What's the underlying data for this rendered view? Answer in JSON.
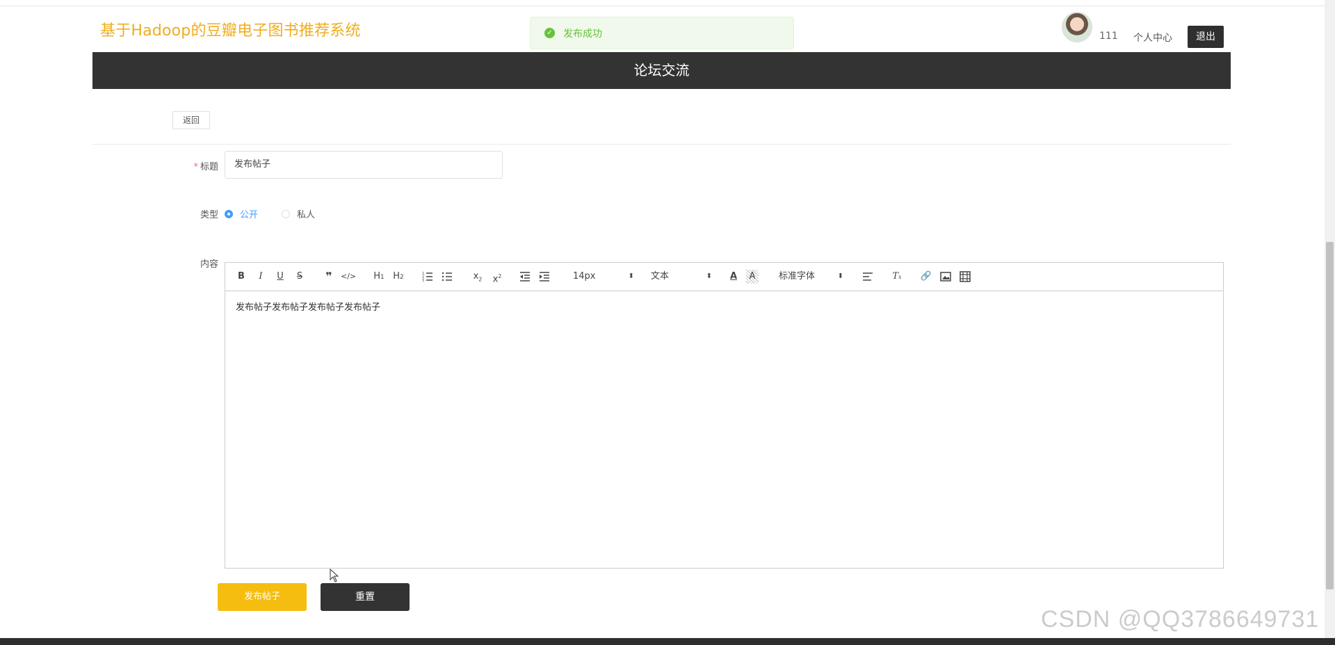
{
  "header": {
    "site_title": "基于Hadoop的豆瓣电子图书推荐系统",
    "username": "111",
    "profile_link": "个人中心",
    "logout": "退出"
  },
  "toast": {
    "icon": "check-circle-icon",
    "message": "发布成功"
  },
  "banner": {
    "title": "论坛交流"
  },
  "back_button": "返回",
  "form": {
    "title_label": "标题",
    "title_value": "发布帖子",
    "type_label": "类型",
    "type_options": [
      "公开",
      "私人"
    ],
    "type_selected": "公开",
    "content_label": "内容",
    "content_value": "发布帖子发布帖子发布帖子发布帖子"
  },
  "editor_toolbar": {
    "buttons": [
      "bold",
      "italic",
      "underline",
      "strike",
      "blockquote",
      "code-block",
      "header-1",
      "header-2",
      "ordered-list",
      "bullet-list",
      "subscript",
      "superscript",
      "indent-decrease",
      "indent-increase",
      "font-color",
      "background-color",
      "align",
      "clean",
      "link",
      "image",
      "video"
    ],
    "size_picker": "14px",
    "header_picker": "文本",
    "font_picker": "标准字体"
  },
  "actions": {
    "submit": "发布帖子",
    "reset": "重置"
  },
  "watermark": "CSDN @QQ3786649731",
  "colors": {
    "brand": "#f0ad1e",
    "banner_bg": "#333333",
    "accent": "#409eff",
    "success": "#67c23a",
    "submit_bg": "#f5bd0f"
  }
}
